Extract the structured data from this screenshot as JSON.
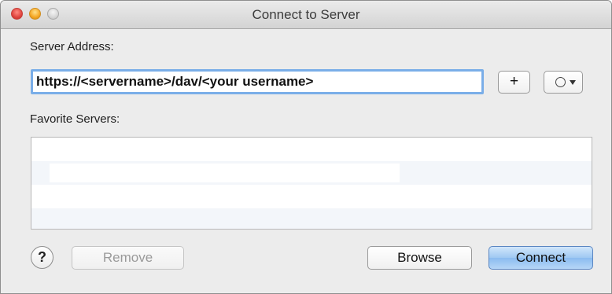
{
  "window": {
    "title": "Connect to Server"
  },
  "server_address": {
    "label": "Server Address:",
    "value": "https://<servername>/dav/<your username>",
    "add_button_label": "+"
  },
  "favorites": {
    "label": "Favorite Servers:",
    "items": []
  },
  "buttons": {
    "help_label": "?",
    "remove_label": "Remove",
    "browse_label": "Browse",
    "connect_label": "Connect"
  },
  "icons": {
    "recent_servers": "clock-icon",
    "dropdown": "chevron-down-icon"
  },
  "colors": {
    "focus_ring": "#7aaee8",
    "default_button": "#9fc9f2"
  }
}
